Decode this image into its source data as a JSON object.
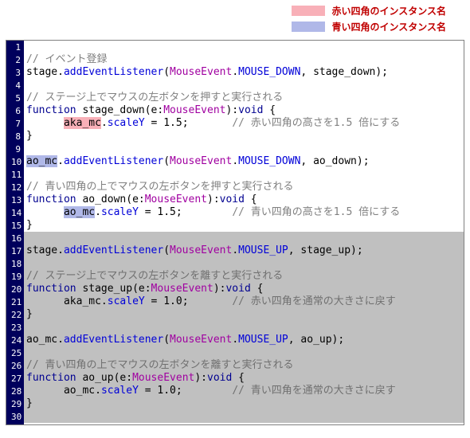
{
  "legend": {
    "red_label": "赤い四角のインスタンス名",
    "blue_label": "青い四角のインスタンス名"
  },
  "lines": {
    "l2": "// イベント登録",
    "l3_a": "stage.",
    "l3_b": "addEventListener",
    "l3_c": "(",
    "l3_d": "MouseEvent",
    "l3_e": ".",
    "l3_f": "MOUSE_DOWN",
    "l3_g": ", stage_down);",
    "l5": "// ステージ上でマウスの左ボタンを押すと実行される",
    "l6_a": "function",
    "l6_b": " stage_down(e:",
    "l6_c": "MouseEvent",
    "l6_d": "):",
    "l6_e": "void",
    "l6_f": " {",
    "l7_pad": "      ",
    "l7_a": "aka_mc",
    "l7_b": ".",
    "l7_c": "scaleY",
    "l7_d": " = 1.5;",
    "l7_gap": "       ",
    "l7_e": "// 赤い四角の高さを1.5 倍にする",
    "l8": "}",
    "l10_a": "ao_mc",
    "l10_b": ".",
    "l10_c": "addEventListener",
    "l10_d": "(",
    "l10_e": "MouseEvent",
    "l10_f": ".",
    "l10_g": "MOUSE_DOWN",
    "l10_h": ", ao_down);",
    "l12": "// 青い四角の上でマウスの左ボタンを押すと実行される",
    "l13_a": "function",
    "l13_b": " ao_down(e:",
    "l13_c": "MouseEvent",
    "l13_d": "):",
    "l13_e": "void",
    "l13_f": " {",
    "l14_pad": "      ",
    "l14_a": "ao_mc",
    "l14_b": ".",
    "l14_c": "scaleY",
    "l14_d": " = 1.5;",
    "l14_gap": "        ",
    "l14_e": "// 青い四角の高さを1.5 倍にする",
    "l15": "}",
    "l17_a": "stage.",
    "l17_b": "addEventListener",
    "l17_c": "(",
    "l17_d": "MouseEvent",
    "l17_e": ".",
    "l17_f": "MOUSE_UP",
    "l17_g": ", stage_up);",
    "l19": "// ステージ上でマウスの左ボタンを離すと実行される",
    "l20_a": "function",
    "l20_b": " stage_up(e:",
    "l20_c": "MouseEvent",
    "l20_d": "):",
    "l20_e": "void",
    "l20_f": " {",
    "l21_pad": "      ",
    "l21_a": "aka_mc.",
    "l21_c": "scaleY",
    "l21_d": " = 1.0;",
    "l21_gap": "       ",
    "l21_e": "// 赤い四角を通常の大きさに戻す",
    "l22": "}",
    "l24_a": "ao_mc.",
    "l24_b": "addEventListener",
    "l24_c": "(",
    "l24_d": "MouseEvent",
    "l24_e": ".",
    "l24_f": "MOUSE_UP",
    "l24_g": ", ao_up);",
    "l26": "// 青い四角の上でマウスの左ボタンを離すと実行される",
    "l27_a": "function",
    "l27_b": " ao_up(e:",
    "l27_c": "MouseEvent",
    "l27_d": "):",
    "l27_e": "void",
    "l27_f": " {",
    "l28_pad": "      ",
    "l28_a": "ao_mc.",
    "l28_c": "scaleY",
    "l28_d": " = 1.0;",
    "l28_gap": "        ",
    "l28_e": "// 青い四角を通常の大きさに戻す",
    "l29": "}"
  },
  "line_count": 30
}
